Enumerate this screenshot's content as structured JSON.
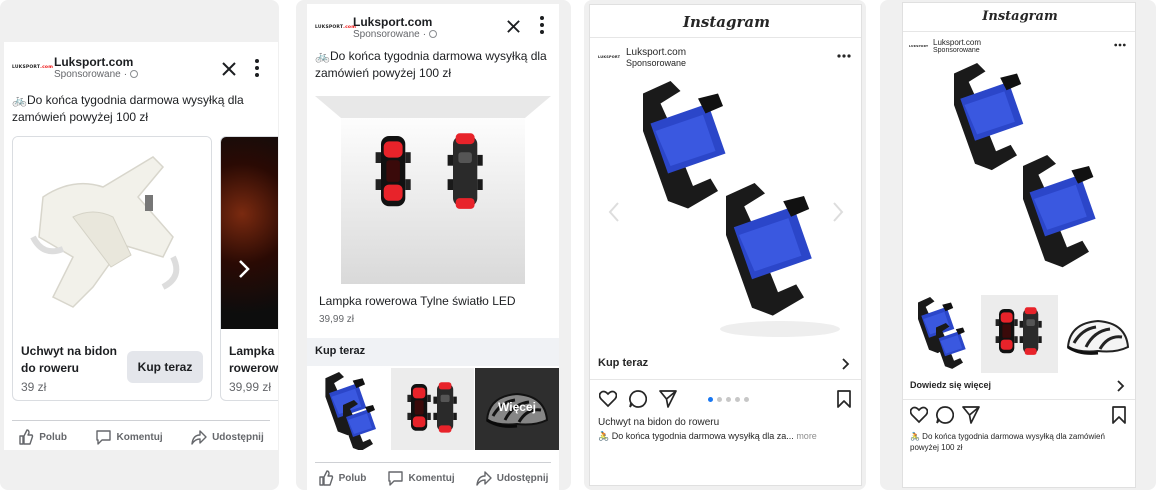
{
  "brand": {
    "name": "Luksport.com",
    "sponsored": "Sponsorowane",
    "logo_text": "LUKSPORT",
    "logo_suffix": ".com"
  },
  "post_text": "🚲Do końca tygodnia darmowa wysyłką dla zamówień powyżej 100 zł",
  "fb_carousel": {
    "cards": [
      {
        "title": "Uchwyt na bidon do roweru",
        "price": "39 zł",
        "cta": "Kup teraz"
      },
      {
        "title": "Lampka rowerowa",
        "price": "39,99 zł"
      }
    ],
    "actions": {
      "like": "Polub",
      "comment": "Komentuj",
      "share": "Udostępnij"
    }
  },
  "fb_collection": {
    "product_title": "Lampka rowerowa Tylne światło LED",
    "product_price": "39,99 zł",
    "cta": "Kup teraz",
    "more": "Więcej",
    "actions": {
      "like": "Polub",
      "comment": "Komentuj",
      "share": "Udostępnij"
    }
  },
  "ig_carousel": {
    "app_title": "Instagram",
    "cta": "Kup teraz",
    "caption_title": "Uchwyt na bidon do roweru",
    "caption": "🚴 Do końca tygodnia darmowa wysyłką dla za...",
    "more": "more",
    "active_dot": 1,
    "dot_count": 5
  },
  "ig_collection": {
    "app_title": "Instagram",
    "cta": "Dowiedz się więcej",
    "caption": "🚴 Do końca tygodnia darmowa wysyłką dla zamówień powyżej 100 zł"
  },
  "colors": {
    "accent_blue": "#2b46c9",
    "fb_blue": "#1877f2",
    "red_light": "#e8232a"
  }
}
